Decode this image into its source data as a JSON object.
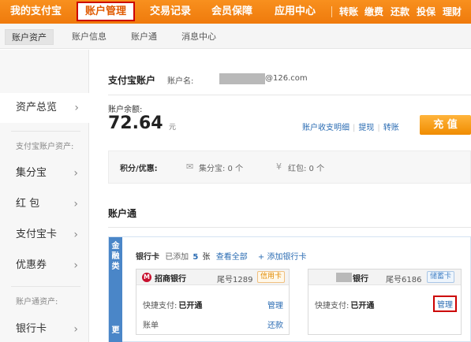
{
  "topnav": {
    "brand": "我的支付宝",
    "active_tab": "账户管理",
    "tabs": [
      "交易记录",
      "会员保障",
      "应用中心"
    ],
    "links": [
      "转账",
      "缴费",
      "还款",
      "投保",
      "理财"
    ]
  },
  "subnav": [
    "账户资产",
    "账户信息",
    "账户通",
    "消息中心"
  ],
  "sidebar": {
    "overview": "资产总览",
    "group1": "支付宝账户资产:",
    "items1": [
      "集分宝",
      "红 包",
      "支付宝卡",
      "优惠券"
    ],
    "group2": "账户通资产:",
    "items2": [
      "银行卡"
    ]
  },
  "account": {
    "title": "支付宝账户",
    "name_label": "账户名:",
    "email_suffix": "@126.com",
    "balance_label": "账户余额:",
    "balance": "72.64",
    "unit": "元",
    "links": [
      "账户收支明细",
      "提现",
      "转账"
    ],
    "topup": "充 值"
  },
  "points": {
    "label": "积分/优惠:",
    "jifenbao": "集分宝: 0 个",
    "hongbao": "红包: 0 个"
  },
  "zhanghutong": {
    "title": "账户通",
    "tab_top": [
      "金",
      "融",
      "类"
    ],
    "tab_more": "更",
    "bank_cards_label": "银行卡",
    "added_label": "已添加",
    "added_count": "5",
    "added_unit": "张",
    "view_all": "查看全部",
    "add_card": "+ 添加银行卡",
    "cards": [
      {
        "bank": "招商银行",
        "tail": "尾号1289",
        "type": "信用卡",
        "quick_pay_label": "快捷支付:",
        "quick_pay_status": "已开通",
        "manage": "管理",
        "bill_label": "账单",
        "repay": "还款"
      },
      {
        "bank": "银行",
        "tail": "尾号6186",
        "type": "储蓄卡",
        "quick_pay_label": "快捷支付:",
        "quick_pay_status": "已开通",
        "manage": "管理"
      }
    ]
  },
  "colors": {
    "nav_orange": "#f08a12",
    "link_blue": "#2b6cb3",
    "highlight_red": "#cc0000",
    "topup_orange": "#f6a21a",
    "finance_blue": "#4a86c8"
  }
}
